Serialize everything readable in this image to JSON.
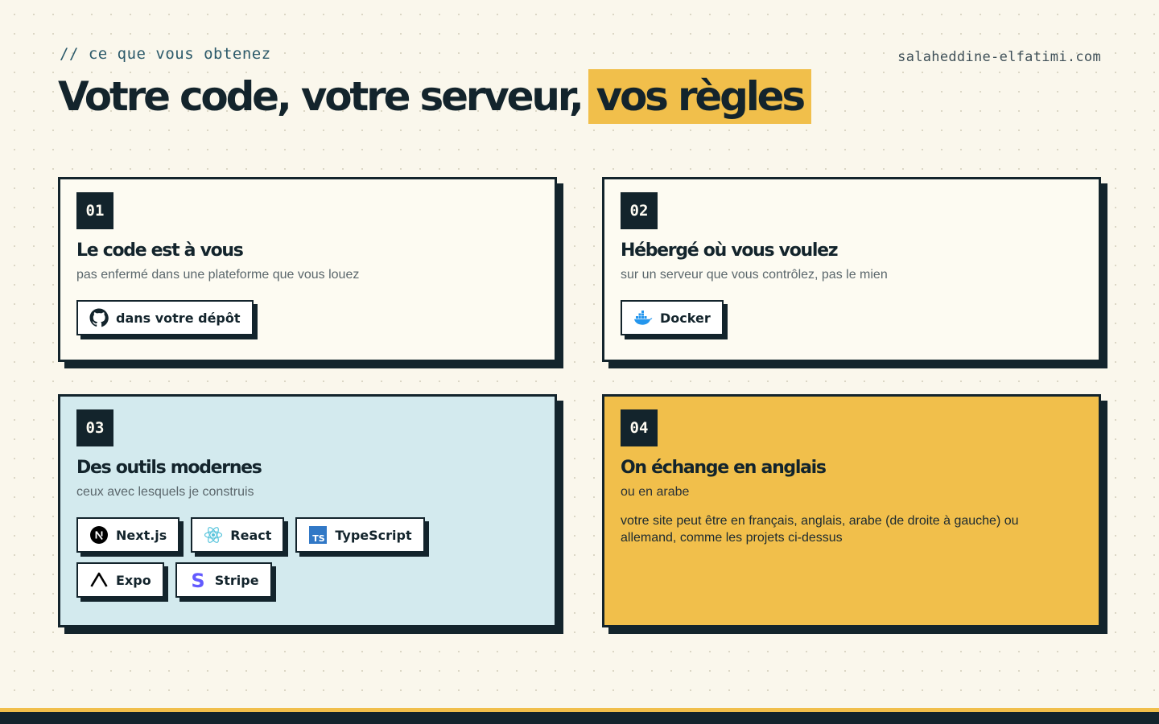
{
  "header": {
    "eyebrow": "// ce que vous obtenez",
    "site": "salaheddine-elfatimi.com",
    "headline_main": "Votre code, votre serveur,",
    "headline_highlight": "vos règles"
  },
  "colors": {
    "dark": "#13242c",
    "accent": "#f1bf4b",
    "cream": "#faf7ec",
    "light_blue": "#d3eaee"
  },
  "cards": [
    {
      "number": "01",
      "title": "Le code est à vous",
      "subtitle": "pas enfermé dans une plateforme que vous louez",
      "chips": [
        {
          "label": "dans votre dépôt",
          "icon": "github-icon"
        }
      ]
    },
    {
      "number": "02",
      "title": "Hébergé où vous voulez",
      "subtitle": "sur un serveur que vous contrôlez, pas le mien",
      "chips": [
        {
          "label": "Docker",
          "icon": "docker-icon"
        }
      ]
    },
    {
      "number": "03",
      "title": "Des outils modernes",
      "subtitle": "ceux avec lesquels je construis",
      "chips": [
        {
          "label": "Next.js",
          "icon": "nextjs-icon"
        },
        {
          "label": "React",
          "icon": "react-icon"
        },
        {
          "label": "TypeScript",
          "icon": "typescript-icon"
        },
        {
          "label": "Expo",
          "icon": "expo-icon"
        },
        {
          "label": "Stripe",
          "icon": "stripe-icon"
        }
      ]
    },
    {
      "number": "04",
      "title": "On échange en anglais",
      "subtitle": "ou en arabe",
      "text": "votre site peut être en français, anglais, arabe (de droite à gauche) ou allemand, comme les projets ci-dessus"
    }
  ]
}
